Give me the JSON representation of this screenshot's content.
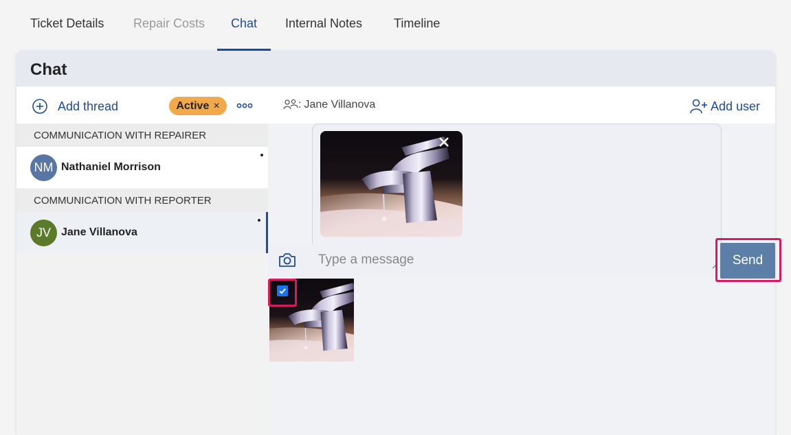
{
  "tabs": [
    {
      "label": "Ticket Details",
      "state": "normal"
    },
    {
      "label": "Repair Costs",
      "state": "disabled"
    },
    {
      "label": "Chat",
      "state": "active"
    },
    {
      "label": "Internal Notes",
      "state": "normal"
    },
    {
      "label": "Timeline",
      "state": "normal"
    }
  ],
  "panel": {
    "title": "Chat"
  },
  "threads": {
    "add_thread_label": "Add thread",
    "status_badge": "Active",
    "status_badge_close": "×",
    "more_icon": "more-horizontal-icon",
    "groups": [
      {
        "title": "COMMUNICATION WITH REPAIRER",
        "items": [
          {
            "initials": "NM",
            "name": "Nathaniel Morrison",
            "avatar_color": "#5876a4",
            "selected": false,
            "unread_dot": true
          }
        ]
      },
      {
        "title": "COMMUNICATION WITH REPORTER",
        "items": [
          {
            "initials": "JV",
            "name": "Jane Villanova",
            "avatar_color": "#5b7a2a",
            "selected": true,
            "unread_dot": true
          }
        ]
      }
    ]
  },
  "chat": {
    "participants_prefix": ":",
    "participants": "Jane Villanova",
    "add_user_label": "Add user",
    "message_placeholder": "Type a message",
    "message_value": "",
    "send_label": "Send",
    "attachment_preview": {
      "image": "faucet-photo",
      "remove_icon": "close-icon"
    },
    "gallery": [
      {
        "image": "faucet-photo",
        "selected": true
      }
    ]
  },
  "colors": {
    "accent": "#1e4aa0",
    "badge": "#f1a94a",
    "send_button": "#5c7fa8",
    "highlight": "#d81b60",
    "checkbox": "#1a73e8"
  }
}
